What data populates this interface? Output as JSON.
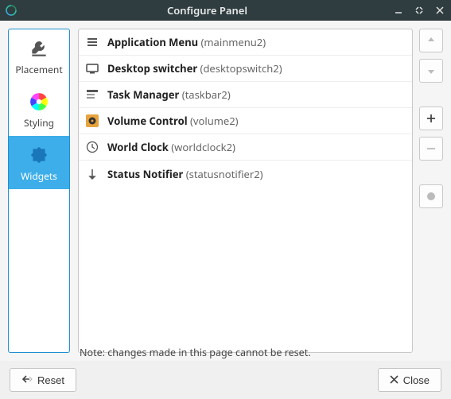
{
  "window": {
    "title": "Configure Panel"
  },
  "sidebar": {
    "items": [
      {
        "label": "Placement"
      },
      {
        "label": "Styling"
      },
      {
        "label": "Widgets"
      }
    ],
    "active_index": 2
  },
  "widgets": [
    {
      "icon": "menu",
      "name": "Application Menu",
      "id": "mainmenu2"
    },
    {
      "icon": "desktop",
      "name": "Desktop switcher",
      "id": "desktopswitch2"
    },
    {
      "icon": "taskbar",
      "name": "Task Manager",
      "id": "taskbar2"
    },
    {
      "icon": "volume",
      "name": "Volume Control",
      "id": "volume2"
    },
    {
      "icon": "clock",
      "name": "World Clock",
      "id": "worldclock2"
    },
    {
      "icon": "status",
      "name": "Status Notifier",
      "id": "statusnotifier2"
    }
  ],
  "note": "Note: changes made in this page cannot be reset.",
  "buttons": {
    "reset": "Reset",
    "close": "Close"
  }
}
